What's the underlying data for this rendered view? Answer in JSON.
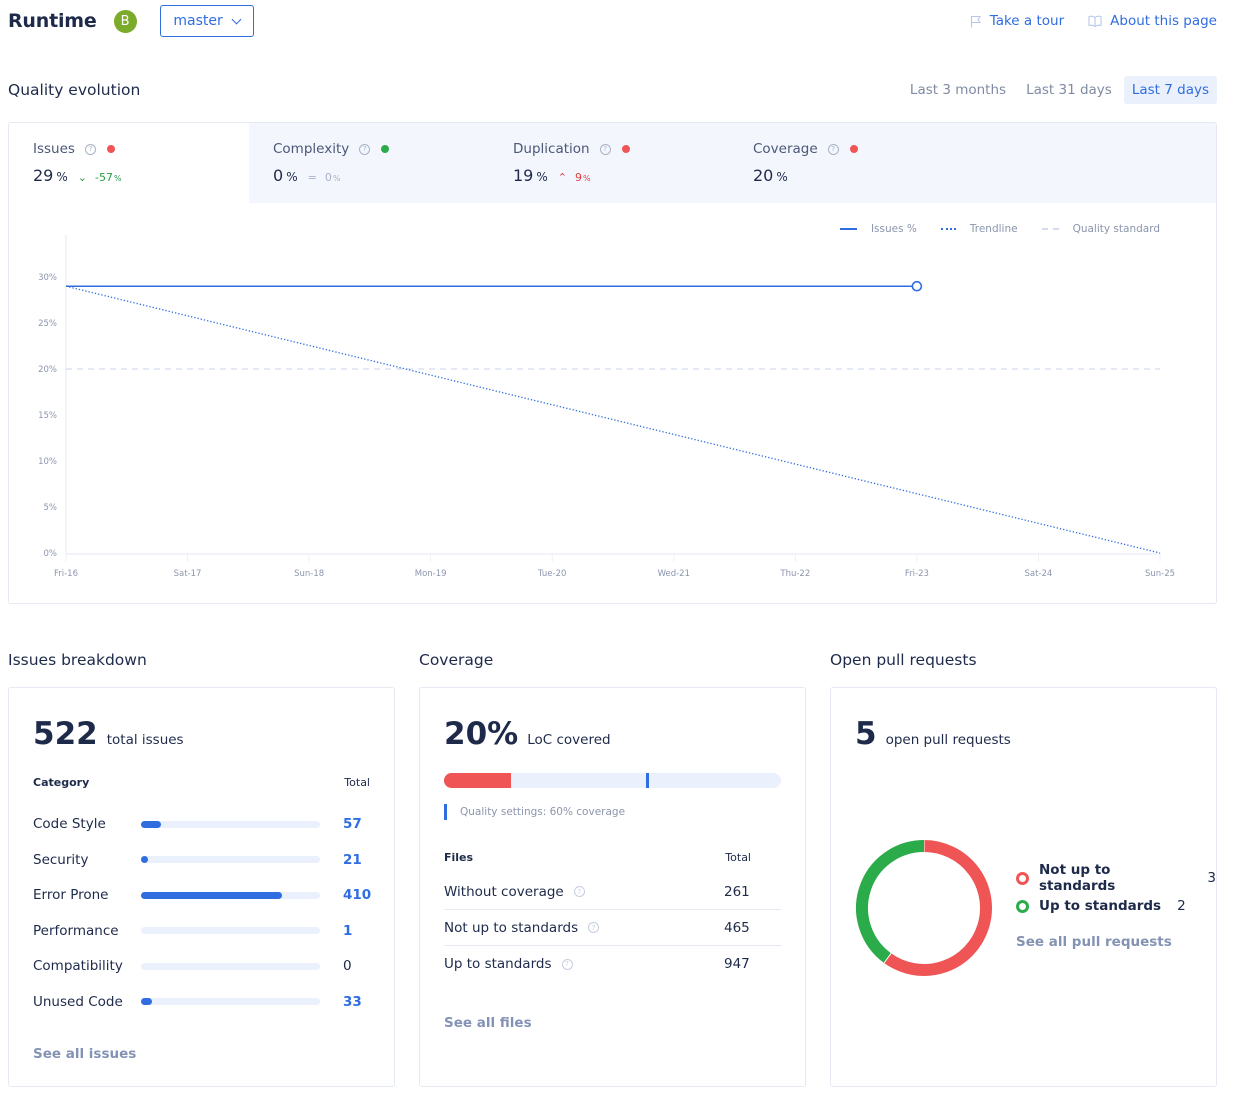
{
  "header": {
    "title": "Runtime",
    "grade": "B",
    "grade_color": "#7cab2b",
    "branch": "master",
    "take_tour": "Take a tour",
    "about_page": "About this page",
    "icons": {
      "tour": "flag-icon",
      "about": "book-icon"
    }
  },
  "quality": {
    "title": "Quality evolution",
    "ranges": [
      {
        "label": "Last 3 months",
        "active": false
      },
      {
        "label": "Last 31 days",
        "active": false
      },
      {
        "label": "Last 7 days",
        "active": true
      }
    ],
    "metrics": [
      {
        "name": "Issues",
        "status": "bad",
        "value": "29",
        "unit": "%",
        "delta_arrow": "⌄",
        "delta": "-57",
        "delta_unit": "%",
        "delta_kind": "good",
        "active": true
      },
      {
        "name": "Complexity",
        "status": "good",
        "value": "0",
        "unit": "%",
        "delta_arrow": "=",
        "delta": "0",
        "delta_unit": "%",
        "delta_kind": "neutral",
        "active": false
      },
      {
        "name": "Duplication",
        "status": "bad",
        "value": "19",
        "unit": "%",
        "delta_arrow": "⌃",
        "delta": "9",
        "delta_unit": "%",
        "delta_kind": "bad",
        "active": false
      },
      {
        "name": "Coverage",
        "status": "bad",
        "value": "20",
        "unit": "%",
        "delta_arrow": "",
        "delta": "",
        "delta_unit": "",
        "delta_kind": "none",
        "active": false
      }
    ],
    "help_glyph": "?",
    "colors": {
      "good": "#2cab4a",
      "bad": "#ef5555",
      "line": "#2f6de1",
      "standard": "#d3dcef"
    }
  },
  "chart_data": {
    "type": "line",
    "title": "",
    "xlabel": "",
    "ylabel": "",
    "x": [
      "Fri-16",
      "Sat-17",
      "Sun-18",
      "Mon-19",
      "Tue-20",
      "Wed-21",
      "Thu-22",
      "Fri-23",
      "Sat-24",
      "Sun-25"
    ],
    "yticks": [
      "0%",
      "5%",
      "10%",
      "15%",
      "20%",
      "25%",
      "30%"
    ],
    "ylim": [
      0,
      30
    ],
    "grid": false,
    "legend_position": "top-right",
    "series": [
      {
        "name": "Issues %",
        "style": "solid",
        "x": [
          "Fri-16",
          "Sat-17",
          "Sun-18",
          "Mon-19",
          "Tue-20",
          "Wed-21",
          "Thu-22",
          "Fri-23"
        ],
        "values": [
          29,
          29,
          29,
          29,
          29,
          29,
          29,
          29
        ]
      },
      {
        "name": "Trendline",
        "style": "dotted",
        "x": [
          "Fri-16",
          "Sun-25"
        ],
        "values": [
          29,
          0
        ]
      },
      {
        "name": "Quality standard",
        "style": "dashed",
        "x": [
          "Fri-16",
          "Sun-25"
        ],
        "values": [
          20,
          20
        ]
      }
    ]
  },
  "issues": {
    "title": "Issues breakdown",
    "total": "522",
    "total_label": "total issues",
    "col_category": "Category",
    "col_total": "Total",
    "max": 522,
    "categories": [
      {
        "name": "Code Style",
        "total": 57
      },
      {
        "name": "Security",
        "total": 21
      },
      {
        "name": "Error Prone",
        "total": 410
      },
      {
        "name": "Performance",
        "total": 1
      },
      {
        "name": "Compatibility",
        "total": 0
      },
      {
        "name": "Unused Code",
        "total": 33
      }
    ],
    "see_all": "See all issues"
  },
  "coverage": {
    "title": "Coverage",
    "value": "20%",
    "label": "LoC covered",
    "covered_fraction": 0.2,
    "goal_fraction": 0.6,
    "goal_note": "Quality settings: 60% coverage",
    "col_files": "Files",
    "col_total": "Total",
    "rows": [
      {
        "name": "Without coverage",
        "total": "261"
      },
      {
        "name": "Not up to standards",
        "total": "465"
      },
      {
        "name": "Up to standards",
        "total": "947"
      }
    ],
    "see_all": "See all files"
  },
  "pull_requests": {
    "title": "Open pull requests",
    "total": "5",
    "total_label": "open pull requests",
    "segments": [
      {
        "name": "Not up to standards",
        "count": 3,
        "color": "#ef5555"
      },
      {
        "name": "Up to standards",
        "count": 2,
        "color": "#2cab4a"
      }
    ],
    "see_all": "See all pull requests"
  }
}
